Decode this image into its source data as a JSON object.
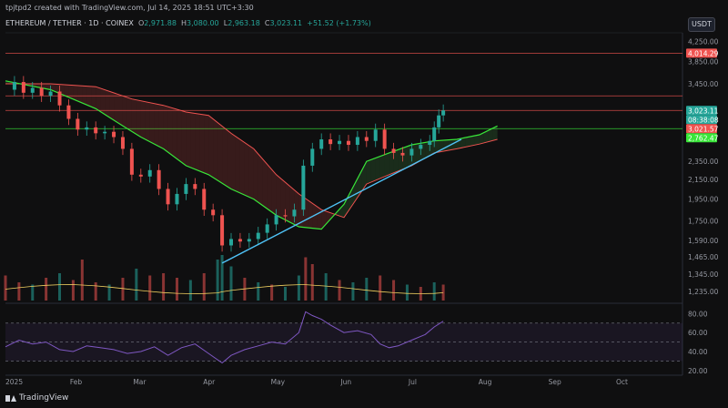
{
  "header": {
    "note": "tpjtpd2 created with TradingView.com, Jul 14, 2025 18:51 UTC+3:30",
    "symbol": "ETHEREUM / TETHER · 1D · COINEX",
    "o_label": "O",
    "o_value": "2,971.88",
    "h_label": "H",
    "h_value": "3,080.00",
    "l_label": "L",
    "l_value": "2,963.18",
    "c_label": "C",
    "c_value": "3,023.11",
    "change": "+51.52 (+1.73%)",
    "currency_button": "USDT"
  },
  "footer": {
    "brand": "TradingView"
  },
  "colors": {
    "background": "#0f0f10",
    "up": "#26a69a",
    "down": "#ef5350",
    "kumo_line_green": "#39e639",
    "kumo_line_red": "#ef5350",
    "trendline": "#4fc3f7",
    "rsi": "#7e57c2",
    "volume_ma": "#f0d060"
  },
  "chart_data": [
    {
      "type": "line",
      "title": "ETHEREUM / TETHER · 1D · COINEX",
      "x_ticks": [
        "2025",
        "Feb",
        "Mar",
        "Apr",
        "May",
        "Jun",
        "Jul",
        "Aug",
        "Sep",
        "Oct"
      ],
      "y_ticks": [
        "4,250.00",
        "3,850.00",
        "3,450.00",
        "2,350.00",
        "2,150.00",
        "1,950.00",
        "1,750.00",
        "1,590.00",
        "1,465.00",
        "1,345.00",
        "1,235.00"
      ],
      "y_scale": "log",
      "ylim": [
        1180,
        4400
      ],
      "price_labels": [
        {
          "text": "4,014.29",
          "value": 4014.29,
          "color": "#ef5350"
        },
        {
          "text": "3,023.11",
          "value": 3023.11,
          "color": "#26a69a"
        },
        {
          "text": "08:38:08",
          "value": 2950,
          "color": "#26a69a"
        },
        {
          "text": "3,021.57",
          "value": 2820,
          "color": "#ef5350"
        },
        {
          "text": "2,762.47",
          "value": 2762.47,
          "color": "#39e639"
        }
      ],
      "horizontal_lines": [
        {
          "value": 4014.29,
          "color": "#ef5350"
        },
        {
          "value": 3250,
          "color": "#ef5350"
        },
        {
          "value": 3023.11,
          "color": "#ef5350"
        },
        {
          "value": 2762.47,
          "color": "#39e639"
        }
      ],
      "close_series": [
        {
          "day": 0,
          "close": 3350
        },
        {
          "day": 4,
          "close": 3480
        },
        {
          "day": 8,
          "close": 3300
        },
        {
          "day": 12,
          "close": 3380
        },
        {
          "day": 16,
          "close": 3250
        },
        {
          "day": 20,
          "close": 3320
        },
        {
          "day": 24,
          "close": 3100
        },
        {
          "day": 28,
          "close": 2900
        },
        {
          "day": 32,
          "close": 2750
        },
        {
          "day": 36,
          "close": 2780
        },
        {
          "day": 40,
          "close": 2700
        },
        {
          "day": 44,
          "close": 2720
        },
        {
          "day": 48,
          "close": 2650
        },
        {
          "day": 52,
          "close": 2500
        },
        {
          "day": 56,
          "close": 2200
        },
        {
          "day": 60,
          "close": 2180
        },
        {
          "day": 64,
          "close": 2250
        },
        {
          "day": 68,
          "close": 2050
        },
        {
          "day": 72,
          "close": 1900
        },
        {
          "day": 76,
          "close": 2000
        },
        {
          "day": 80,
          "close": 2100
        },
        {
          "day": 84,
          "close": 2050
        },
        {
          "day": 88,
          "close": 1850
        },
        {
          "day": 92,
          "close": 1800
        },
        {
          "day": 96,
          "close": 1550
        },
        {
          "day": 100,
          "close": 1600
        },
        {
          "day": 104,
          "close": 1580
        },
        {
          "day": 108,
          "close": 1600
        },
        {
          "day": 112,
          "close": 1650
        },
        {
          "day": 116,
          "close": 1720
        },
        {
          "day": 120,
          "close": 1800
        },
        {
          "day": 124,
          "close": 1790
        },
        {
          "day": 128,
          "close": 1850
        },
        {
          "day": 132,
          "close": 2300
        },
        {
          "day": 136,
          "close": 2500
        },
        {
          "day": 140,
          "close": 2620
        },
        {
          "day": 144,
          "close": 2560
        },
        {
          "day": 148,
          "close": 2600
        },
        {
          "day": 152,
          "close": 2550
        },
        {
          "day": 156,
          "close": 2650
        },
        {
          "day": 160,
          "close": 2600
        },
        {
          "day": 164,
          "close": 2750
        },
        {
          "day": 168,
          "close": 2500
        },
        {
          "day": 172,
          "close": 2450
        },
        {
          "day": 176,
          "close": 2420
        },
        {
          "day": 180,
          "close": 2500
        },
        {
          "day": 184,
          "close": 2550
        },
        {
          "day": 188,
          "close": 2600
        },
        {
          "day": 190,
          "close": 2780
        },
        {
          "day": 192,
          "close": 2950
        },
        {
          "day": 194,
          "close": 3023.11
        }
      ],
      "kumo_green_line": [
        {
          "day": 0,
          "value": 3500
        },
        {
          "day": 20,
          "value": 3350
        },
        {
          "day": 40,
          "value": 3050
        },
        {
          "day": 52,
          "value": 2800
        },
        {
          "day": 60,
          "value": 2650
        },
        {
          "day": 70,
          "value": 2500
        },
        {
          "day": 80,
          "value": 2300
        },
        {
          "day": 90,
          "value": 2200
        },
        {
          "day": 100,
          "value": 2050
        },
        {
          "day": 110,
          "value": 1950
        },
        {
          "day": 120,
          "value": 1800
        },
        {
          "day": 130,
          "value": 1700
        },
        {
          "day": 140,
          "value": 1680
        },
        {
          "day": 150,
          "value": 1900
        },
        {
          "day": 160,
          "value": 2350
        },
        {
          "day": 170,
          "value": 2450
        },
        {
          "day": 180,
          "value": 2550
        },
        {
          "day": 190,
          "value": 2600
        },
        {
          "day": 200,
          "value": 2620
        },
        {
          "day": 210,
          "value": 2680
        },
        {
          "day": 218,
          "value": 2800
        }
      ],
      "kumo_red_line": [
        {
          "day": 0,
          "value": 3450
        },
        {
          "day": 20,
          "value": 3450
        },
        {
          "day": 40,
          "value": 3400
        },
        {
          "day": 56,
          "value": 3200
        },
        {
          "day": 70,
          "value": 3100
        },
        {
          "day": 80,
          "value": 3000
        },
        {
          "day": 90,
          "value": 2950
        },
        {
          "day": 100,
          "value": 2700
        },
        {
          "day": 110,
          "value": 2500
        },
        {
          "day": 120,
          "value": 2200
        },
        {
          "day": 130,
          "value": 2000
        },
        {
          "day": 140,
          "value": 1850
        },
        {
          "day": 150,
          "value": 1780
        },
        {
          "day": 160,
          "value": 2100
        },
        {
          "day": 170,
          "value": 2200
        },
        {
          "day": 180,
          "value": 2300
        },
        {
          "day": 190,
          "value": 2450
        },
        {
          "day": 200,
          "value": 2500
        },
        {
          "day": 210,
          "value": 2560
        },
        {
          "day": 218,
          "value": 2620
        }
      ],
      "trendline": [
        {
          "day": 96,
          "value": 1420
        },
        {
          "day": 202,
          "value": 2620
        }
      ],
      "volume": {
        "ma_color": "#f0d060",
        "bars": [
          {
            "day": 0,
            "v": 0.55
          },
          {
            "day": 6,
            "v": 0.4
          },
          {
            "day": 12,
            "v": 0.35
          },
          {
            "day": 18,
            "v": 0.5
          },
          {
            "day": 24,
            "v": 0.6
          },
          {
            "day": 30,
            "v": 0.45
          },
          {
            "day": 34,
            "v": 0.9
          },
          {
            "day": 40,
            "v": 0.4
          },
          {
            "day": 46,
            "v": 0.35
          },
          {
            "day": 52,
            "v": 0.5
          },
          {
            "day": 58,
            "v": 0.7
          },
          {
            "day": 64,
            "v": 0.55
          },
          {
            "day": 70,
            "v": 0.6
          },
          {
            "day": 76,
            "v": 0.5
          },
          {
            "day": 82,
            "v": 0.45
          },
          {
            "day": 88,
            "v": 0.6
          },
          {
            "day": 94,
            "v": 0.9
          },
          {
            "day": 96,
            "v": 1.0
          },
          {
            "day": 100,
            "v": 0.75
          },
          {
            "day": 106,
            "v": 0.5
          },
          {
            "day": 112,
            "v": 0.4
          },
          {
            "day": 118,
            "v": 0.35
          },
          {
            "day": 124,
            "v": 0.3
          },
          {
            "day": 130,
            "v": 0.55
          },
          {
            "day": 133,
            "v": 0.95
          },
          {
            "day": 136,
            "v": 0.8
          },
          {
            "day": 142,
            "v": 0.6
          },
          {
            "day": 148,
            "v": 0.45
          },
          {
            "day": 154,
            "v": 0.4
          },
          {
            "day": 160,
            "v": 0.5
          },
          {
            "day": 166,
            "v": 0.55
          },
          {
            "day": 172,
            "v": 0.45
          },
          {
            "day": 178,
            "v": 0.35
          },
          {
            "day": 184,
            "v": 0.3
          },
          {
            "day": 190,
            "v": 0.4
          },
          {
            "day": 194,
            "v": 0.35
          }
        ]
      }
    },
    {
      "type": "line",
      "title": "",
      "y_ticks": [
        "80.00",
        "60.00",
        "40.00",
        "20.00"
      ],
      "ylim": [
        15,
        90
      ],
      "bands": [
        70,
        50,
        30
      ],
      "rsi": [
        {
          "day": 0,
          "v": 45
        },
        {
          "day": 6,
          "v": 52
        },
        {
          "day": 12,
          "v": 48
        },
        {
          "day": 18,
          "v": 50
        },
        {
          "day": 24,
          "v": 42
        },
        {
          "day": 30,
          "v": 40
        },
        {
          "day": 36,
          "v": 46
        },
        {
          "day": 42,
          "v": 44
        },
        {
          "day": 48,
          "v": 42
        },
        {
          "day": 54,
          "v": 38
        },
        {
          "day": 60,
          "v": 40
        },
        {
          "day": 66,
          "v": 45
        },
        {
          "day": 72,
          "v": 36
        },
        {
          "day": 78,
          "v": 44
        },
        {
          "day": 84,
          "v": 48
        },
        {
          "day": 90,
          "v": 38
        },
        {
          "day": 96,
          "v": 28
        },
        {
          "day": 100,
          "v": 36
        },
        {
          "day": 106,
          "v": 42
        },
        {
          "day": 112,
          "v": 46
        },
        {
          "day": 118,
          "v": 50
        },
        {
          "day": 124,
          "v": 48
        },
        {
          "day": 130,
          "v": 60
        },
        {
          "day": 133,
          "v": 82
        },
        {
          "day": 136,
          "v": 78
        },
        {
          "day": 140,
          "v": 74
        },
        {
          "day": 144,
          "v": 68
        },
        {
          "day": 150,
          "v": 60
        },
        {
          "day": 156,
          "v": 62
        },
        {
          "day": 162,
          "v": 58
        },
        {
          "day": 166,
          "v": 48
        },
        {
          "day": 170,
          "v": 44
        },
        {
          "day": 174,
          "v": 46
        },
        {
          "day": 180,
          "v": 52
        },
        {
          "day": 186,
          "v": 58
        },
        {
          "day": 190,
          "v": 66
        },
        {
          "day": 194,
          "v": 72
        }
      ]
    }
  ]
}
